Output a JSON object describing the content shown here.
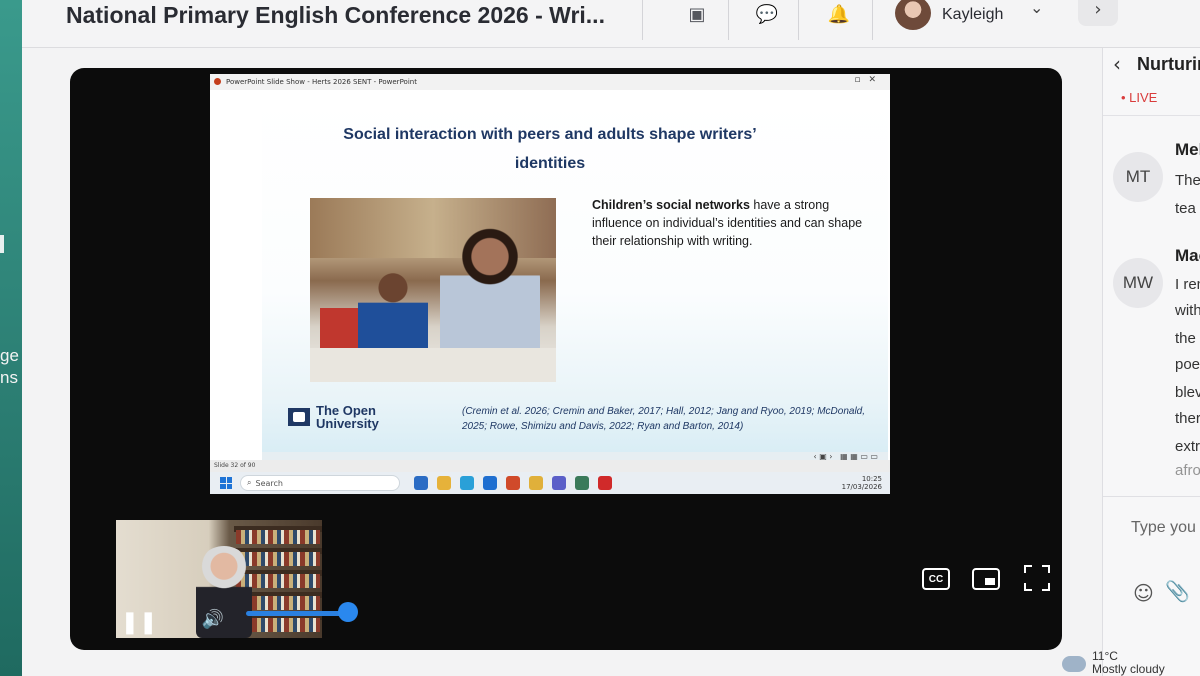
{
  "header": {
    "event_title": "National Primary English Conference 2026 - Wri...",
    "user_name": "Kayleigh"
  },
  "sidebar_peek": {
    "line1": "ge",
    "line2": "ns"
  },
  "ppt": {
    "window_title": "PowerPoint Slide Show - Herts 2026 SENT - PowerPoint",
    "slide_title_line1": "Social interaction with peers and adults shape writers’",
    "slide_title_line2": "identities",
    "text_bold": "Children’s social networks",
    "text_rest": " have a strong influence on individual’s identities and can shape their relationship with writing.",
    "logo_line1": "The Open",
    "logo_line2": "University",
    "citations": "(Cremin et al. 2026; Cremin and Baker, 2017; Hall, 2012; Jang and Ryoo, 2019; McDonald, 2025; Rowe, Shimizu and Davis, 2022; Ryan and Barton, 2014)",
    "slide_counter": "Slide 32 of 90",
    "taskbar_search": "Search",
    "clock_time": "10:25",
    "clock_date": "17/03/2026"
  },
  "player": {
    "cc_label": "CC"
  },
  "chat": {
    "title": "Nurturing",
    "live_label": "• LIVE",
    "messages": [
      {
        "initials": "MT",
        "name": "Mel",
        "lines": [
          "The",
          "tea"
        ]
      },
      {
        "initials": "MW",
        "name": "Mac",
        "lines": [
          "I rem",
          "with",
          "the",
          "poe",
          "blev",
          "ther",
          "extr",
          "afro"
        ]
      }
    ],
    "input_placeholder": "Type you"
  },
  "weather": {
    "temp": "11°C",
    "desc": "Mostly cloudy"
  }
}
